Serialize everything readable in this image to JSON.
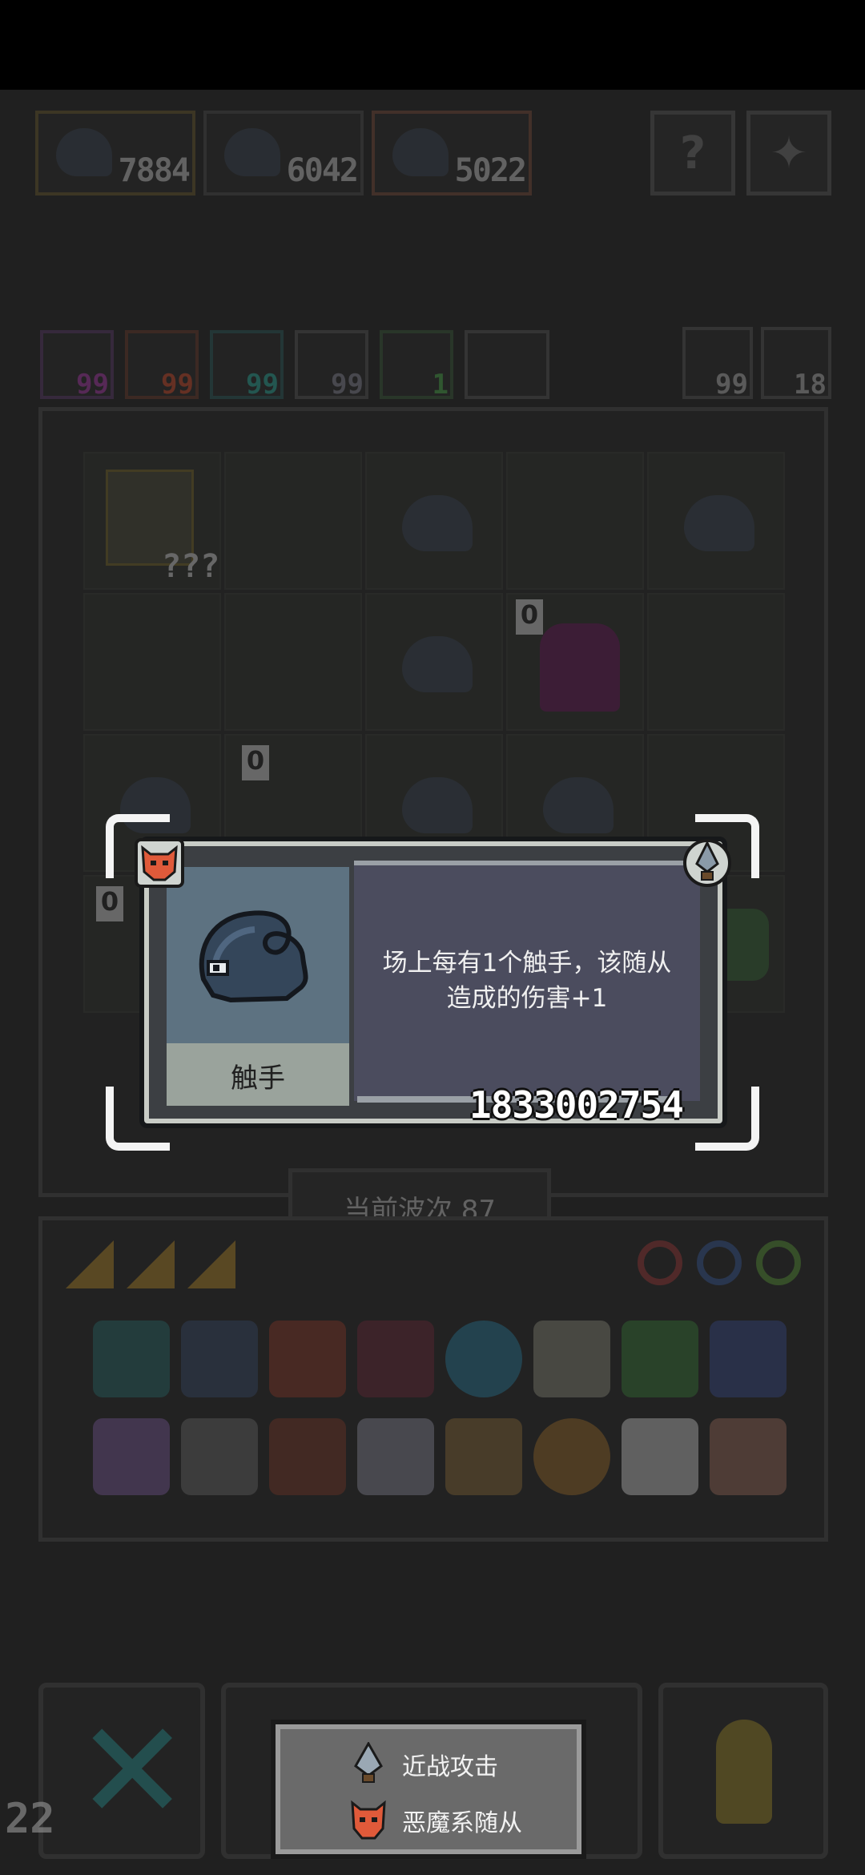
{
  "top_resources": [
    {
      "value": "7884"
    },
    {
      "value": "6042"
    },
    {
      "value": "5022"
    }
  ],
  "top_buttons": {
    "help_glyph": "?",
    "settings_glyph": "✦"
  },
  "stats": [
    {
      "value": "99",
      "color": "#b03ab0"
    },
    {
      "value": "99",
      "color": "#d84a2a"
    },
    {
      "value": "99",
      "color": "#2ab0a0"
    },
    {
      "value": "99",
      "color": "#8a8a9a"
    },
    {
      "value": "1",
      "color": "#4ab04a"
    }
  ],
  "stats_right": [
    {
      "value": "99"
    },
    {
      "value": "18"
    }
  ],
  "board": {
    "hero_label": "???",
    "level_badges": [
      "0",
      "0",
      "0"
    ]
  },
  "wave": {
    "label": "当前波次 87"
  },
  "popup": {
    "unit_name": "触手",
    "description_line1": "场上每有1个触手，该随从",
    "description_line2": "造成的伤害+1",
    "unit_id": "1833002754",
    "type_icon": "demon-mask-icon",
    "attack_icon": "spearhead-icon"
  },
  "tags_tooltip": {
    "tags": [
      {
        "label": "近战攻击",
        "icon": "spearhead-icon"
      },
      {
        "label": "恶魔系随从",
        "icon": "demon-mask-icon"
      }
    ]
  },
  "corner_counter": "22",
  "colors": {
    "accent_demon": "#e05a3a",
    "popup_right_bg": "#4b4c5e",
    "popup_left_bg": "#5d7281"
  }
}
